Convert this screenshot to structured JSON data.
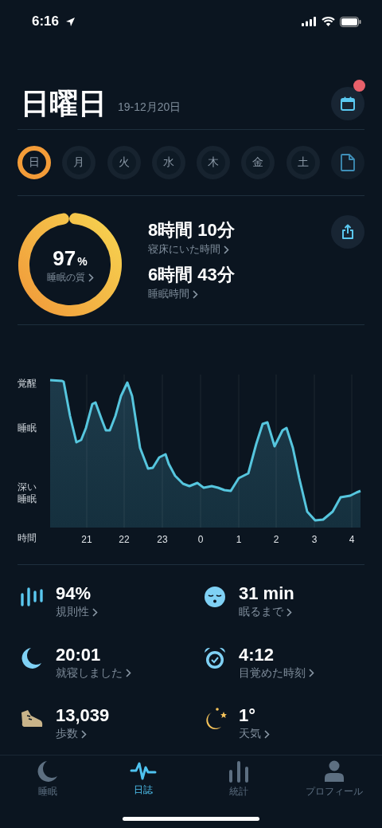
{
  "status_bar": {
    "time": "6:16"
  },
  "header": {
    "title": "日曜日",
    "date": "19-12月20日",
    "calendar_badge": true
  },
  "days": [
    {
      "label": "日",
      "selected": true
    },
    {
      "label": "月",
      "selected": false
    },
    {
      "label": "火",
      "selected": false
    },
    {
      "label": "水",
      "selected": false
    },
    {
      "label": "木",
      "selected": false
    },
    {
      "label": "金",
      "selected": false
    },
    {
      "label": "土",
      "selected": false
    }
  ],
  "summary": {
    "quality": {
      "value": "97",
      "unit": "%",
      "label": "睡眠の質"
    },
    "metrics": [
      {
        "value": "8時間 10分",
        "label": "寝床にいた時間"
      },
      {
        "value": "6時間 43分",
        "label": "睡眠時間"
      }
    ]
  },
  "chart": {
    "y_labels": [
      "覚醒",
      "睡眠",
      "深い睡眠"
    ],
    "x_title": "時間",
    "x_labels": [
      "21",
      "22",
      "23",
      "0",
      "1",
      "2",
      "3",
      "4"
    ]
  },
  "stats": [
    {
      "kind": "regularity",
      "value": "94%",
      "label": "規則性"
    },
    {
      "kind": "fall_asleep",
      "value": "31 min",
      "label": "眠るまで"
    },
    {
      "kind": "bedtime",
      "value": "20:01",
      "label": "就寝しました"
    },
    {
      "kind": "wake",
      "value": "4:12",
      "label": "目覚めた時刻"
    },
    {
      "kind": "steps",
      "value": "13,039",
      "label": "歩数"
    },
    {
      "kind": "weather",
      "value": "1°",
      "label": "天気"
    }
  ],
  "tabs": [
    {
      "kind": "sleep",
      "label": "睡眠",
      "selected": false
    },
    {
      "kind": "journal",
      "label": "日誌",
      "selected": true
    },
    {
      "kind": "stats",
      "label": "統計",
      "selected": false
    },
    {
      "kind": "profile",
      "label": "プロフィール",
      "selected": false
    }
  ]
}
